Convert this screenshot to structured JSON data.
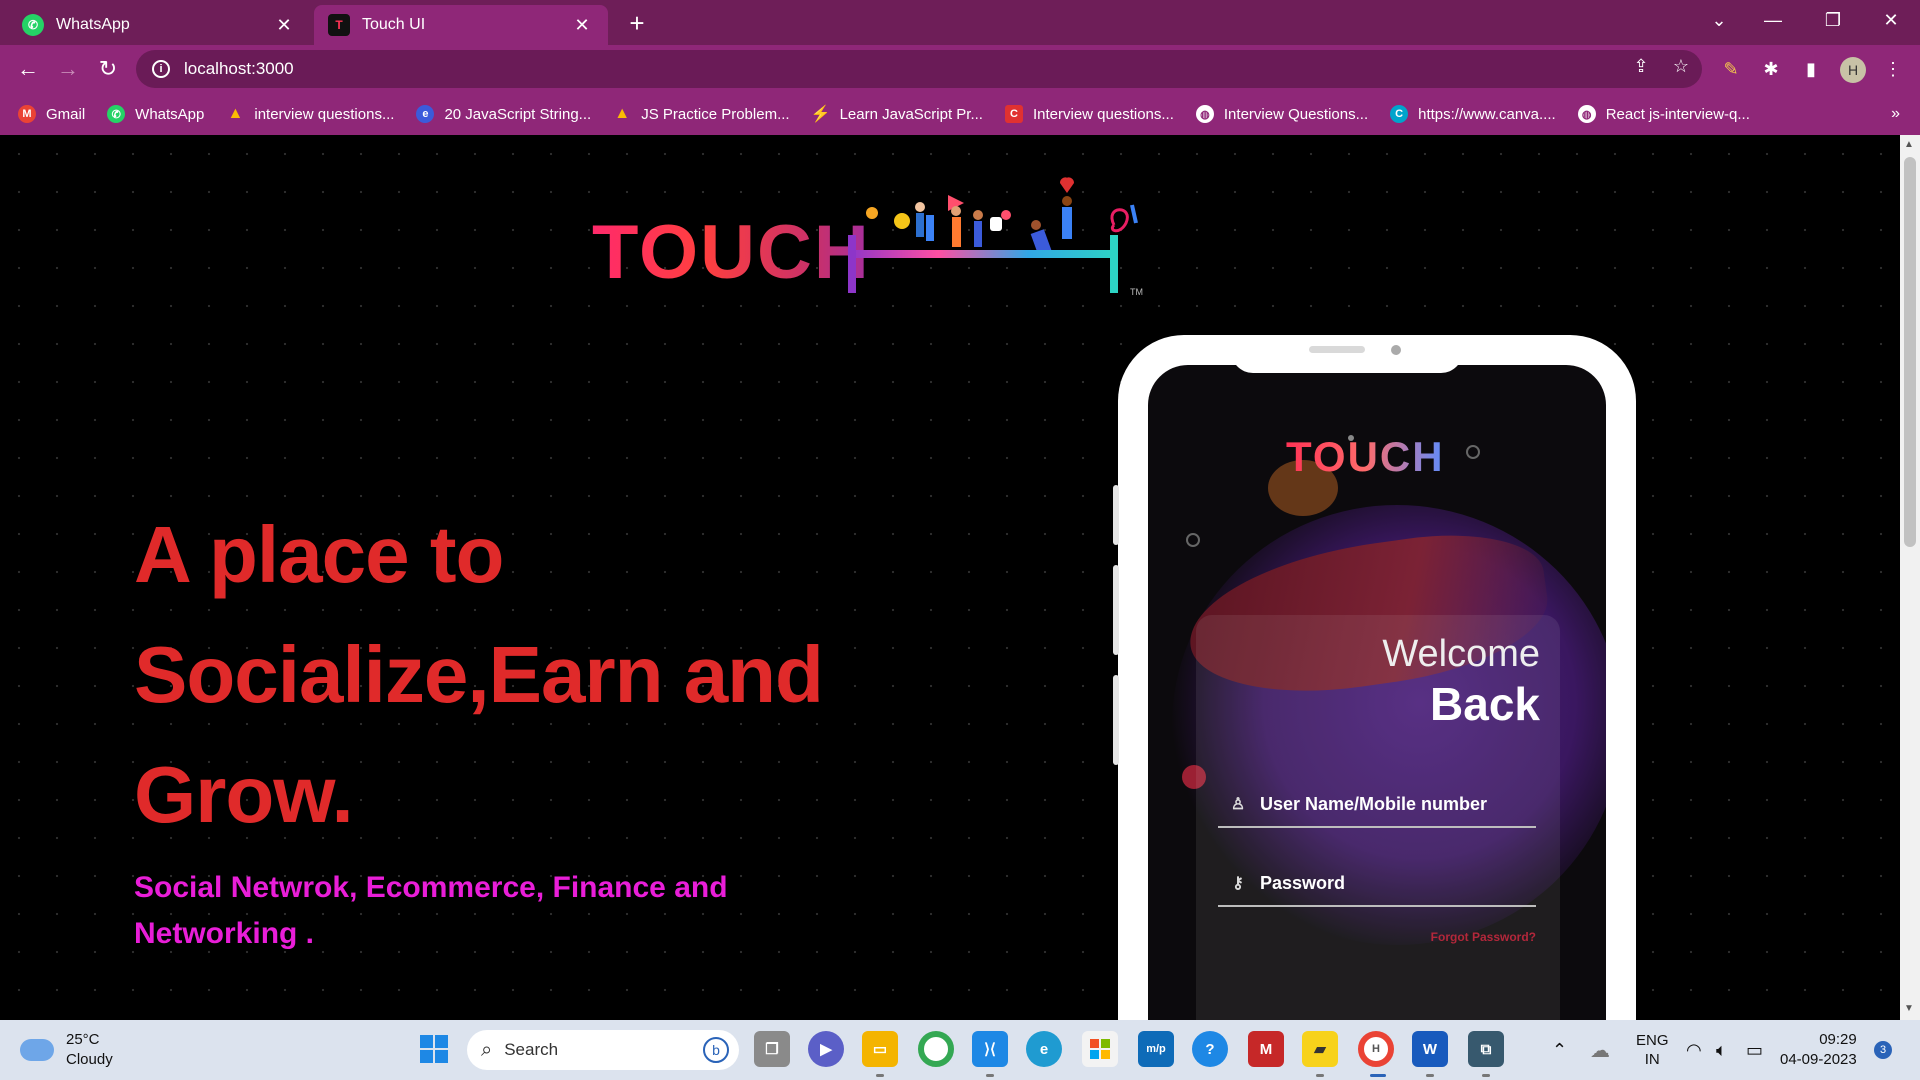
{
  "browser": {
    "tabs": [
      {
        "title": "WhatsApp",
        "favicon": "whatsapp-icon",
        "active": false
      },
      {
        "title": "Touch UI",
        "favicon": "touch-t-icon",
        "active": true
      }
    ],
    "new_tab_label": "+",
    "url": "localhost:3000",
    "avatar_initial": "H",
    "bookmarks": [
      {
        "label": "Gmail",
        "icon": "gmail-icon",
        "color": "#ea4335"
      },
      {
        "label": "WhatsApp",
        "icon": "whatsapp-icon",
        "color": "#25d366"
      },
      {
        "label": "interview questions...",
        "icon": "drive-icon",
        "color": "#fbbc04"
      },
      {
        "label": "20 JavaScript String...",
        "icon": "el-icon",
        "color": "#3b5bdb"
      },
      {
        "label": "JS Practice Problem...",
        "icon": "drive-icon",
        "color": "#fbbc04"
      },
      {
        "label": "Learn JavaScript Pr...",
        "icon": "bolt-icon",
        "color": "#7c3aed"
      },
      {
        "label": "Interview questions...",
        "icon": "c-icon",
        "color": "#e03131"
      },
      {
        "label": "Interview Questions...",
        "icon": "globe-icon",
        "color": "#ffffff"
      },
      {
        "label": "https://www.canva....",
        "icon": "canva-icon",
        "color": "#00c4cc"
      },
      {
        "label": "React js-interview-q...",
        "icon": "globe-icon",
        "color": "#ffffff"
      }
    ]
  },
  "page": {
    "logo_text": "TOUCH",
    "logo_tm": "TM",
    "headline": [
      "A place to",
      "Socialize,Earn and",
      "Grow."
    ],
    "subline": [
      "Social Netwrok, Ecommerce, Finance and",
      "Networking ."
    ],
    "phone": {
      "logo": "TOUCH",
      "welcome_line1": "Welcome",
      "welcome_line2": "Back",
      "username_placeholder": "User Name/Mobile number",
      "password_placeholder": "Password",
      "forgot_password": "Forgot Password?"
    }
  },
  "taskbar": {
    "weather_temp": "25°C",
    "weather_desc": "Cloudy",
    "search_label": "Search",
    "lang_line1": "ENG",
    "lang_line2": "IN",
    "time": "09:29",
    "date": "04-09-2023",
    "notification_count": "3",
    "chrome_badge": "H"
  },
  "colors": {
    "tab_strip": "#6e1e58",
    "toolbar": "#8f2778",
    "headline": "#e02a2a",
    "subline": "#e91ed8"
  }
}
